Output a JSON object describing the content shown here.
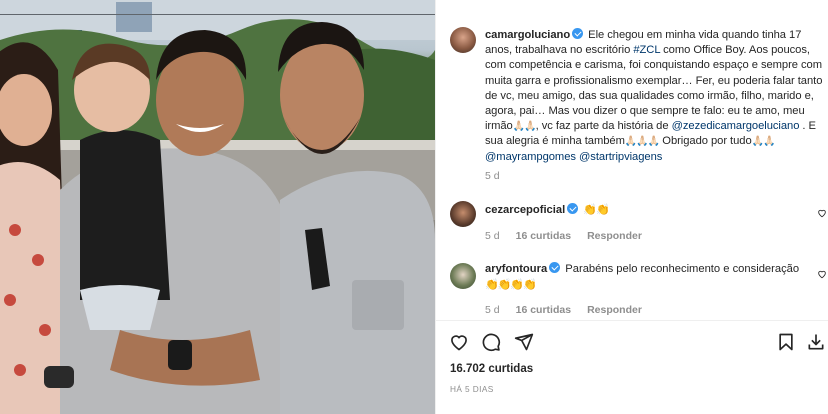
{
  "photo": {
    "alt_subject": "family-photo"
  },
  "post": {
    "username": "camargoluciano",
    "caption_parts": {
      "p1": "Ele chegou em minha vida quando tinha 17 anos, trabalhava no escritório ",
      "tag_zcl": "#ZCL",
      "p2": " como Office Boy. Aos poucos, com competência e carisma, foi conquistando espaço e sempre com muita garra e profissionalismo exemplar… Fer, eu poderia falar tanto de vc, meu amigo, das sua qualidades como irmão, filho, marido e, agora, pai… Mas vou dizer o que sempre te falo: eu te amo, meu irmão",
      "p3": ", vc faz parte da história de ",
      "mention_zeze": "@zezedicamargoeluciano",
      "p4": " . E sua alegria é minha também",
      "p5": "Obrigado por tudo",
      "mention_mayra": "@mayrampgomes",
      "mention_star": "@startripviagens"
    },
    "emoji_hands": "🙏🏻🙏🏻",
    "emoji_hands3": "🙏🏻🙏🏻🙏🏻",
    "caption_time": "5 d",
    "comments": [
      {
        "user": "cezarcepoficial",
        "text": "👏👏",
        "time": "5 d",
        "likes": "16 curtidas",
        "reply": "Responder"
      },
      {
        "user": "aryfontoura",
        "text": "Parabéns pelo reconhecimento e consideração",
        "emoji": "👏👏👏👏",
        "time": "5 d",
        "likes": "16 curtidas",
        "reply": "Responder"
      }
    ],
    "likes_count": "16.702 curtidas",
    "posted_ago": "HÁ 5 DIAS"
  },
  "colors": {
    "link": "#00376b",
    "verified": "#3897f0",
    "muted": "#8e8e8e"
  }
}
